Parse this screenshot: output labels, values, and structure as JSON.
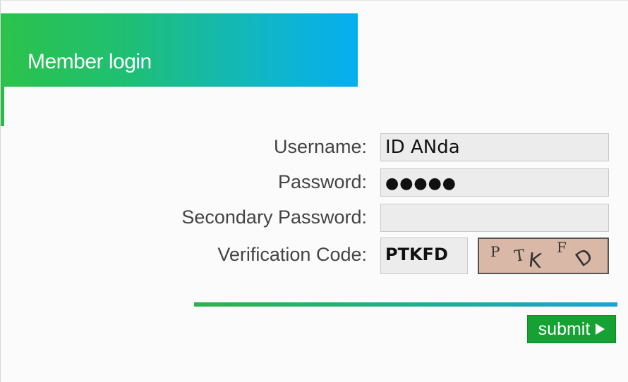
{
  "header": {
    "title": "Member login"
  },
  "form": {
    "username": {
      "label": "Username:",
      "value": "ID ANda"
    },
    "password": {
      "label": "Password:",
      "value": "●●●●●"
    },
    "secondary_password": {
      "label": "Secondary Password:",
      "value": ""
    },
    "verification": {
      "label": "Verification Code:",
      "value": "PTKFD",
      "captcha_chars": [
        "P",
        "T",
        "K",
        "F",
        "D"
      ]
    }
  },
  "submit": {
    "label": "submit",
    "icon": "play-icon"
  },
  "colors": {
    "banner_start": "#2cc24a",
    "banner_end": "#05aef0",
    "submit_bg": "#15a233",
    "captcha_bg": "#d9b8a8"
  }
}
